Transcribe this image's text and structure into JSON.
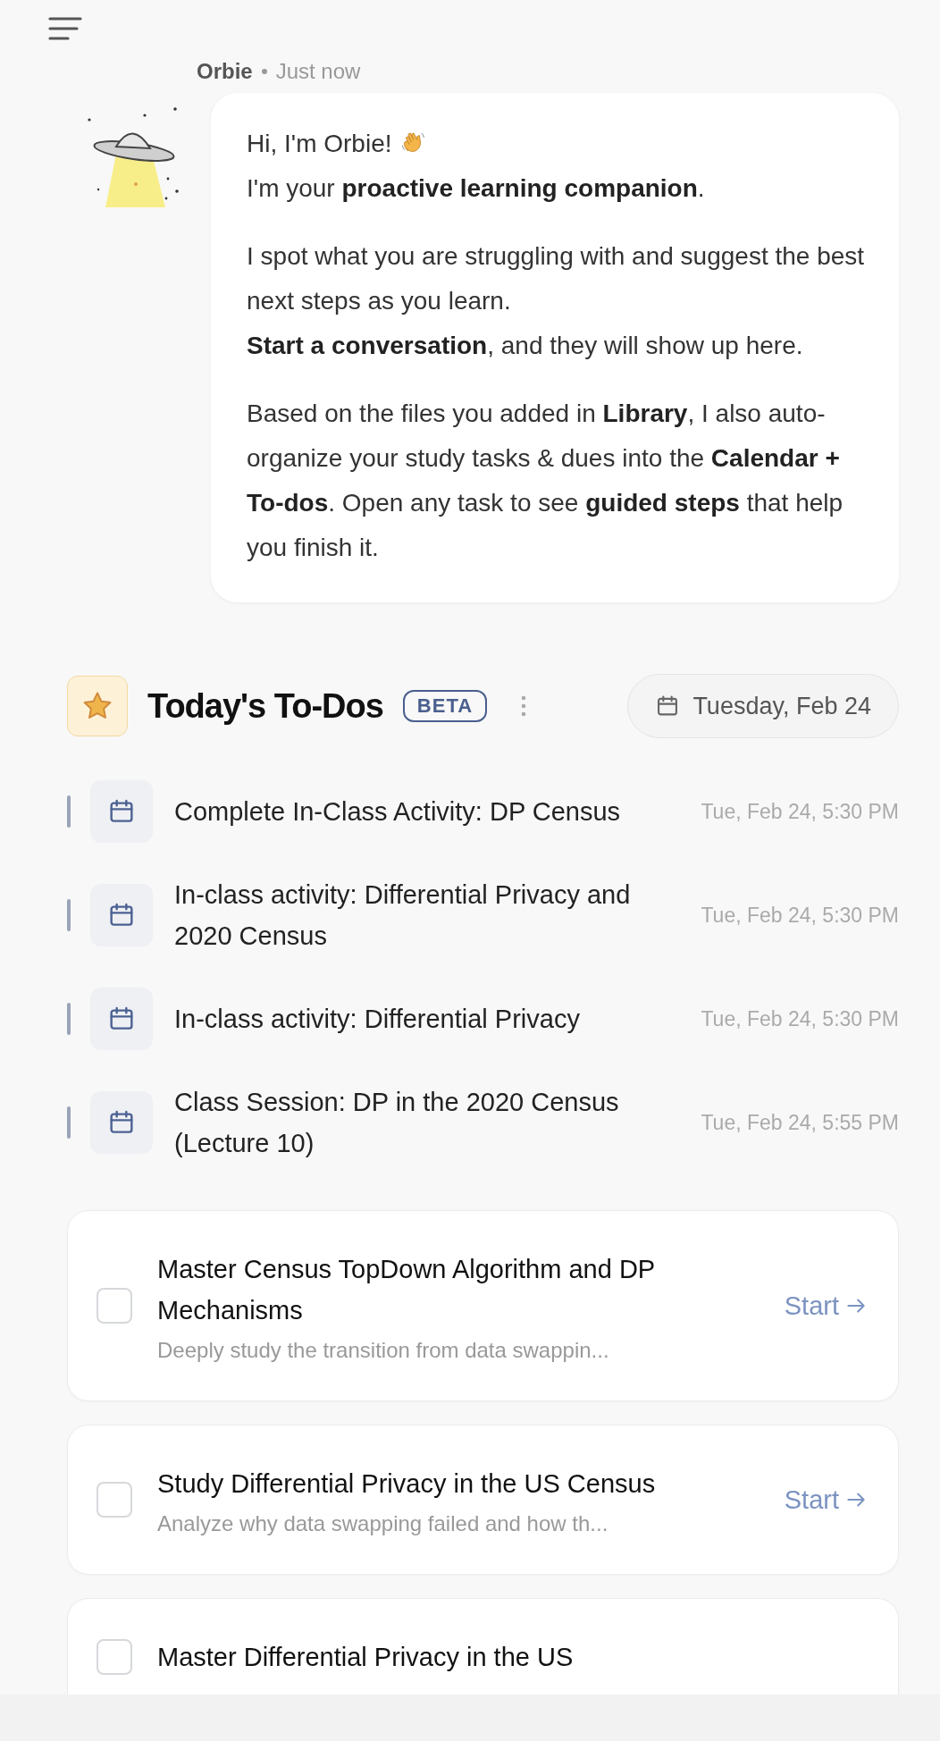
{
  "message": {
    "sender": "Orbie",
    "time": "Just now",
    "paragraphs": [
      [
        "Hi, I'm Orbie!",
        "I'm your **proactive learning companion**."
      ],
      [
        "I spot what you are struggling with and suggest the best next steps as you learn.",
        "**Start a conversation**, and they will show up here."
      ],
      [
        "Based on the files you added in **Library**, I also auto-organize your study tasks & dues into the **Calendar + To-dos**. Open any task to see **guided steps** that help you finish it."
      ]
    ]
  },
  "todos": {
    "title": "Today's To-Dos",
    "badge": "BETA",
    "date": "Tuesday, Feb 24",
    "events": [
      {
        "title": "Complete In-Class Activity: DP Census",
        "time": "Tue, Feb 24, 5:30 PM"
      },
      {
        "title": "In-class activity: Differential Privacy and 2020 Census",
        "time": "Tue, Feb 24, 5:30 PM"
      },
      {
        "title": "In-class activity: Differential Privacy",
        "time": "Tue, Feb 24, 5:30 PM"
      },
      {
        "title": "Class Session: DP in the 2020 Census (Lecture 10)",
        "time": "Tue, Feb 24, 5:55 PM"
      }
    ],
    "tasks": [
      {
        "title": "Master Census TopDown Algorithm and DP Mechanisms",
        "description": "Deeply study the transition from data swappin...",
        "checked": false,
        "action": "Start"
      },
      {
        "title": "Study Differential Privacy in the US Census",
        "description": "Analyze why data swapping failed and how th...",
        "checked": false,
        "action": "Start"
      },
      {
        "title": "Master Differential Privacy in the US",
        "checked": false
      }
    ]
  }
}
